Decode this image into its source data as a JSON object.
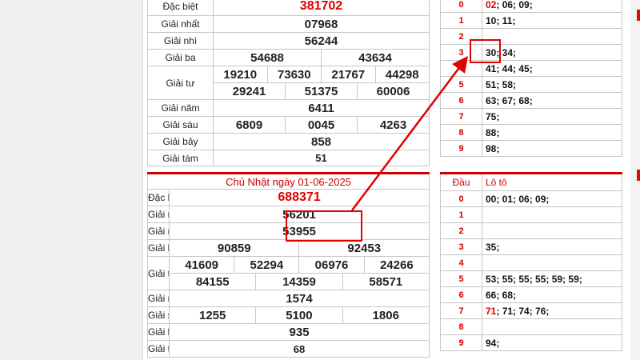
{
  "block1": {
    "rows": [
      {
        "label": "Đặc biệt",
        "values": [
          "381702"
        ]
      },
      {
        "label": "Giải nhất",
        "values": [
          "07968"
        ]
      },
      {
        "label": "Giải nhì",
        "values": [
          "56244"
        ]
      },
      {
        "label": "Giải ba",
        "values": [
          "54688",
          "43634"
        ]
      },
      {
        "label": "Giải tư",
        "values": [
          "19210",
          "73630",
          "21767",
          "44298"
        ],
        "values2": [
          "29241",
          "51375",
          "60006"
        ]
      },
      {
        "label": "Giải năm",
        "values": [
          "6411"
        ]
      },
      {
        "label": "Giải sáu",
        "values": [
          "6809",
          "0045",
          "4263"
        ]
      },
      {
        "label": "Giải bảy",
        "values": [
          "858"
        ]
      },
      {
        "label": "Giải tám",
        "values": [
          "51"
        ]
      }
    ]
  },
  "loto1": {
    "rows": [
      {
        "dau": "0",
        "red": "02",
        "rest": "; 06; 09;"
      },
      {
        "dau": "1",
        "red": "",
        "rest": "10; 11;"
      },
      {
        "dau": "2",
        "red": "",
        "rest": ""
      },
      {
        "dau": "3",
        "red": "",
        "rest": "30; 34;"
      },
      {
        "dau": "4",
        "red": "",
        "rest": "41; 44; 45;"
      },
      {
        "dau": "5",
        "red": "",
        "rest": "51; 58;"
      },
      {
        "dau": "6",
        "red": "",
        "rest": "63; 67; 68;"
      },
      {
        "dau": "7",
        "red": "",
        "rest": "75;"
      },
      {
        "dau": "8",
        "red": "",
        "rest": "88;"
      },
      {
        "dau": "9",
        "red": "",
        "rest": "98;"
      }
    ]
  },
  "block2": {
    "title": "Chủ Nhật ngày 01-06-2025",
    "rows": [
      {
        "label": "Đặc biệt",
        "values": [
          "688371"
        ]
      },
      {
        "label": "Giải nhất",
        "values": [
          "56201"
        ]
      },
      {
        "label": "Giải nhì",
        "values": [
          "53955"
        ]
      },
      {
        "label": "Giải ba",
        "values": [
          "90859",
          "92453"
        ]
      },
      {
        "label": "Giải tư",
        "values": [
          "41609",
          "52294",
          "06976",
          "24266"
        ],
        "values2": [
          "84155",
          "14359",
          "58571"
        ]
      },
      {
        "label": "Giải năm",
        "values": [
          "1574"
        ]
      },
      {
        "label": "Giải sáu",
        "values": [
          "1255",
          "5100",
          "1806"
        ]
      },
      {
        "label": "Giải bảy",
        "values": [
          "935"
        ]
      },
      {
        "label": "Giải tám",
        "values": [
          "68"
        ]
      }
    ]
  },
  "loto2": {
    "head_dau": "Đầu",
    "head_loto": "Lô tô",
    "rows": [
      {
        "dau": "0",
        "red": "",
        "rest": "00; 01; 06; 09;"
      },
      {
        "dau": "1",
        "red": "",
        "rest": ""
      },
      {
        "dau": "2",
        "red": "",
        "rest": ""
      },
      {
        "dau": "3",
        "red": "",
        "rest": "35;"
      },
      {
        "dau": "4",
        "red": "",
        "rest": ""
      },
      {
        "dau": "5",
        "red": "",
        "rest": "53; 55; 55; 55; 59; 59;"
      },
      {
        "dau": "6",
        "red": "",
        "rest": "66; 68;"
      },
      {
        "dau": "7",
        "red": "71",
        "rest": "; 71; 74; 76;"
      },
      {
        "dau": "8",
        "red": "",
        "rest": ""
      },
      {
        "dau": "9",
        "red": "",
        "rest": "94;"
      }
    ]
  },
  "colors": {
    "accent": "#cc0000",
    "highlight": "#e00000",
    "border": "#c6c6c6"
  }
}
